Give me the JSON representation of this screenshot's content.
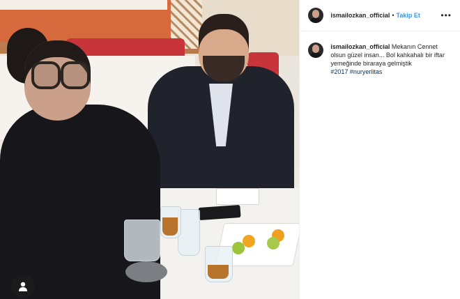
{
  "post": {
    "username": "ismailozkan_official",
    "separator": "•",
    "follow_label": "Takip Et",
    "more_label": "•••",
    "caption": "Mekanın Cennet olsun güzel insan... Bol kahkahalı bir iftar yemeğinde biraraya gelmiştik",
    "hashtags": [
      "#2017",
      "#nuryerlitas"
    ]
  },
  "icons": {
    "more": "more-options-icon",
    "tagged_user": "tagged-user-icon",
    "avatar": "profile-avatar"
  },
  "colors": {
    "link_blue": "#3897f0",
    "hashtag": "#003569",
    "text": "#262626"
  }
}
